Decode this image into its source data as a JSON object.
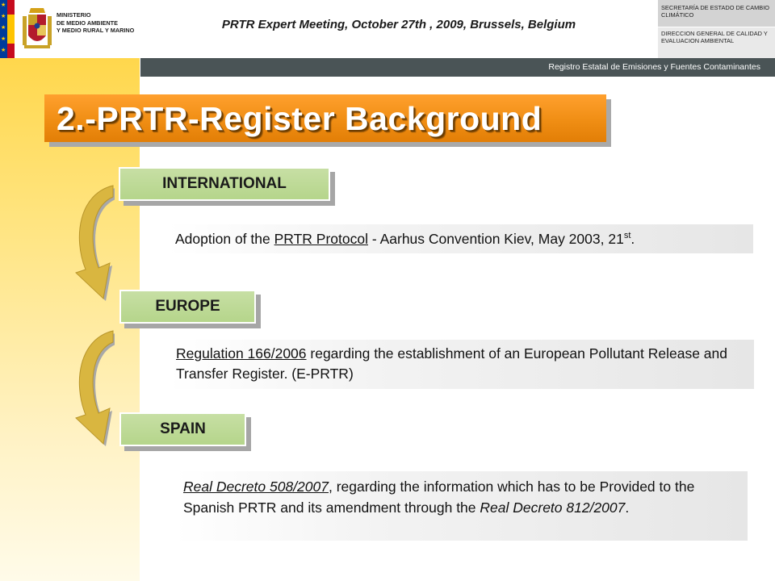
{
  "header": {
    "ministry_line1": "MINISTERIO",
    "ministry_line2": "DE MEDIO AMBIENTE",
    "ministry_line3": "Y MEDIO RURAL Y MARINO",
    "meeting_title": "PRTR Expert Meeting, October 27th , 2009, Brussels, Belgium",
    "secretaria": "SECRETARÍA DE ESTADO DE CAMBIO CLIMÁTICO",
    "direccion": "DIRECCION GENERAL DE CALIDAD Y EVALUACION AMBIENTAL",
    "registry_bar": "Registro Estatal de Emisiones y Fuentes Contaminantes"
  },
  "slide": {
    "title": "2.-PRTR-Register Background"
  },
  "sections": {
    "international": {
      "label": "INTERNATIONAL",
      "text_pre": "Adoption of the ",
      "text_link": "PRTR Protocol",
      "text_post": "  - Aarhus Convention Kiev, May 2003, 21",
      "text_sup": "st",
      "text_end": "."
    },
    "europe": {
      "label": "EUROPE",
      "text_link": "Regulation 166/2006",
      "text_post": " regarding the establishment of an European Pollutant Release and Transfer Register. (E-PRTR)"
    },
    "spain": {
      "label": "SPAIN",
      "text_link": "Real Decreto 508/2007",
      "text_mid": ", regarding the information which has to be Provided to the Spanish PRTR and its amendment  through the ",
      "text_it": "Real Decreto 812/2007",
      "text_end": "."
    }
  },
  "colors": {
    "title_orange": "#f08e14",
    "label_green": "#b5d58b",
    "registry_bar": "#4a5456",
    "arrow_gold": "#d9b640"
  },
  "icons": [
    "spain-crest-icon",
    "eu-flag-icon",
    "spain-flag-icon",
    "curved-arrow-icon"
  ]
}
